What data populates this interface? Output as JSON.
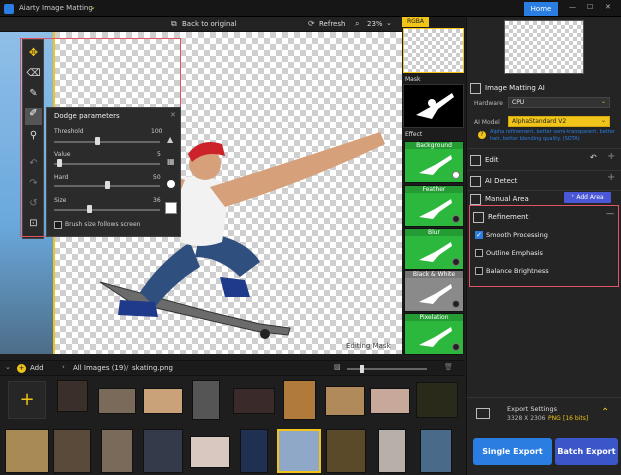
{
  "app": {
    "title": "Aiarty Image Matting",
    "home_label": "Home"
  },
  "toolbar": {
    "back_label": "Back to original",
    "refresh_label": "Refresh",
    "zoom": "23%"
  },
  "effects": {
    "rgba_label": "RGBA",
    "mask_label": "Mask",
    "effect_label": "Effect",
    "items": [
      "Background",
      "Feather",
      "Blur",
      "Black & White",
      "Pixelation"
    ]
  },
  "canvas": {
    "mode_label": "Editing Mask"
  },
  "dodge": {
    "title": "Dodge parameters",
    "threshold": {
      "label": "Threshold",
      "value": "100",
      "level": 0.5
    },
    "value": {
      "label": "Value",
      "value": "5",
      "level": 0.05
    },
    "hard": {
      "label": "Hard",
      "value": "50",
      "level": 0.5
    },
    "size": {
      "label": "Size",
      "value": "36",
      "level": 0.35
    },
    "follow_label": "Brush size follows screen"
  },
  "panel": {
    "matting_title": "Image Matting AI",
    "hardware_label": "Hardware",
    "hardware_value": "CPU",
    "model_label": "AI Model",
    "model_value": "AlphaStandard  V2",
    "model_desc": "Alpha refinement, better semi-transparent, better hair, better blending quality. (SOTA)",
    "edit_label": "Edit",
    "ai_detect_label": "AI Detect",
    "manual_label": "Manual Area",
    "add_area_label": "Add Area",
    "refinement_label": "Refinement",
    "options": [
      {
        "label": "Smooth Processing",
        "checked": true
      },
      {
        "label": "Outline Emphasis",
        "checked": false
      },
      {
        "label": "Balance Brightness",
        "checked": false
      }
    ]
  },
  "gallery": {
    "add_label": "Add",
    "breadcrumb": "All Images (19)",
    "file": "skating.png"
  },
  "export": {
    "settings_label": "Export Settings",
    "dims": "3328 X 2306",
    "format": "PNG",
    "bits": "[16 bits]",
    "single_label": "Single Export",
    "batch_label": "Batch Export"
  },
  "colors": {
    "accent": "#2a7de1",
    "highlight": "#e05565",
    "yellow": "#f0c419",
    "green": "#2cb83c"
  }
}
